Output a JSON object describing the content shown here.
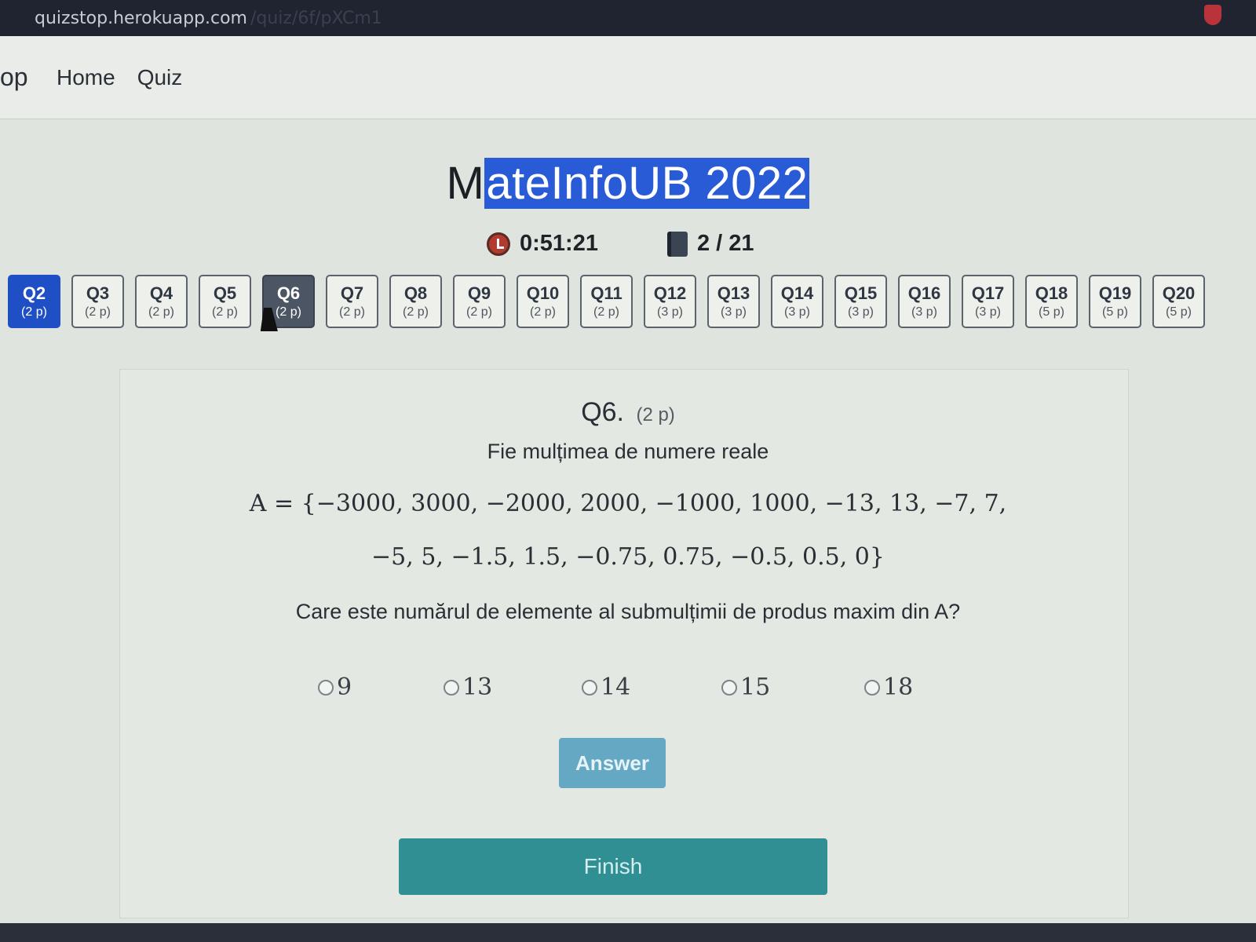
{
  "browser": {
    "url_host": "quizstop.herokuapp.com",
    "url_path": "/quiz/6f/pXCm1"
  },
  "navbar": {
    "brand": "op",
    "links": [
      "Home",
      "Quiz"
    ]
  },
  "page": {
    "title_prefix": "M",
    "title_selected": "ateInfoUB 2022",
    "timer": "0:51:21",
    "progress": "2 / 21"
  },
  "question_nav": [
    {
      "label": "Q2",
      "points": "(2 p)",
      "state": "answered"
    },
    {
      "label": "Q3",
      "points": "(2 p)",
      "state": "default"
    },
    {
      "label": "Q4",
      "points": "(2 p)",
      "state": "default"
    },
    {
      "label": "Q5",
      "points": "(2 p)",
      "state": "default"
    },
    {
      "label": "Q6",
      "points": "(2 p)",
      "state": "current"
    },
    {
      "label": "Q7",
      "points": "(2 p)",
      "state": "default"
    },
    {
      "label": "Q8",
      "points": "(2 p)",
      "state": "default"
    },
    {
      "label": "Q9",
      "points": "(2 p)",
      "state": "default"
    },
    {
      "label": "Q10",
      "points": "(2 p)",
      "state": "default"
    },
    {
      "label": "Q11",
      "points": "(2 p)",
      "state": "default"
    },
    {
      "label": "Q12",
      "points": "(3 p)",
      "state": "default"
    },
    {
      "label": "Q13",
      "points": "(3 p)",
      "state": "default"
    },
    {
      "label": "Q14",
      "points": "(3 p)",
      "state": "default"
    },
    {
      "label": "Q15",
      "points": "(3 p)",
      "state": "default"
    },
    {
      "label": "Q16",
      "points": "(3 p)",
      "state": "default"
    },
    {
      "label": "Q17",
      "points": "(3 p)",
      "state": "default"
    },
    {
      "label": "Q18",
      "points": "(5 p)",
      "state": "default"
    },
    {
      "label": "Q19",
      "points": "(5 p)",
      "state": "default"
    },
    {
      "label": "Q20",
      "points": "(5 p)",
      "state": "default"
    }
  ],
  "question": {
    "number": "Q6.",
    "points": "(2 p)",
    "intro": "Fie mulțimea de numere reale",
    "math_line1": "A = {−3000, 3000, −2000, 2000, −1000, 1000, −13, 13, −7, 7,",
    "math_line2": "−5, 5, −1.5, 1.5, −0.75, 0.75, −0.5, 0.5, 0}",
    "prompt": "Care este numărul de elemente al submulțimii de produs maxim din A?",
    "options": [
      "9",
      "13",
      "14",
      "15",
      "18"
    ],
    "answer_label": "Answer",
    "finish_label": "Finish"
  },
  "colors": {
    "answered": "#1f4fc4",
    "current": "#4b5563",
    "answer_button": "#65a8c4",
    "finish_button": "#2f8f93",
    "selection": "#2a5bd7"
  }
}
